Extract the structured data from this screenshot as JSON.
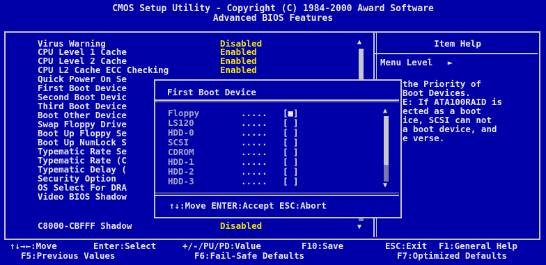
{
  "header": {
    "title_line1": "CMOS Setup Utility - Copyright (C) 1984-2000 Award Software",
    "title_line2": "Advanced BIOS Features"
  },
  "settings": [
    {
      "label": "Virus Warning",
      "value": "Disabled"
    },
    {
      "label": "CPU Level 1 Cache",
      "value": "Enabled"
    },
    {
      "label": "CPU Level 2 Cache",
      "value": "Enabled"
    },
    {
      "label": "CPU L2 Cache ECC Checking",
      "value": "Enabled"
    },
    {
      "label": "Quick Power On Se",
      "value": ""
    },
    {
      "label": "First Boot Device",
      "value": ""
    },
    {
      "label": "Second Boot Devic",
      "value": ""
    },
    {
      "label": "Third Boot Device",
      "value": ""
    },
    {
      "label": "Boot Other Device",
      "value": ""
    },
    {
      "label": "Swap Floppy Drive",
      "value": ""
    },
    {
      "label": "Boot Up Floppy Se",
      "value": ""
    },
    {
      "label": "Boot Up NumLock S",
      "value": ""
    },
    {
      "label": "Typematic Rate Se",
      "value": ""
    },
    {
      "label": "Typematic Rate (C",
      "value": ""
    },
    {
      "label": "Typematic Delay (",
      "value": ""
    },
    {
      "label": "Security Option",
      "value": ""
    },
    {
      "label": "OS Select For DRA",
      "value": ""
    },
    {
      "label": "Video BIOS Shadow",
      "value": ""
    },
    {
      "label": "C8000-CBFFF Shadow",
      "value": "Disabled"
    }
  ],
  "help": {
    "title": "Item Help",
    "menu_level": "Menu Level",
    "menu_level_arrow": "►",
    "lines": [
      "the Priority of",
      "Boot Devices.",
      "E: If ATA100RAID is",
      "ected as a boot",
      "ice, SCSI can not",
      "a boot device, and",
      "e verse."
    ]
  },
  "popup": {
    "title": "First Boot Device",
    "options": [
      {
        "device": "Floppy",
        "dots": ".....",
        "box": "[■]"
      },
      {
        "device": "LS120",
        "dots": ".....",
        "box": "[ ]"
      },
      {
        "device": "HDD-0",
        "dots": ".....",
        "box": "[ ]"
      },
      {
        "device": "SCSI",
        "dots": ".....",
        "box": "[ ]"
      },
      {
        "device": "CDROM",
        "dots": ".....",
        "box": "[ ]"
      },
      {
        "device": "HDD-1",
        "dots": ".....",
        "box": "[ ]"
      },
      {
        "device": "HDD-2",
        "dots": ".....",
        "box": "[ ]"
      },
      {
        "device": "HDD-3",
        "dots": ".....",
        "box": "[ ]"
      }
    ],
    "footer": "↑↓:Move ENTER:Accept ESC:Abort"
  },
  "footer": {
    "move": "↑↓→←:Move",
    "select": "Enter:Select",
    "value": "+/-/PU/PD:Value",
    "save": "F10:Save",
    "exit": "ESC:Exit",
    "help": "F1:General Help",
    "previous": "F5:Previous Values",
    "failsafe": "F6:Fail-Safe Defaults",
    "optimized": "F7:Optimized Defaults"
  },
  "colors": {
    "background": "#0000a8",
    "text": "#e8e8e8",
    "value": "#f4e600"
  }
}
